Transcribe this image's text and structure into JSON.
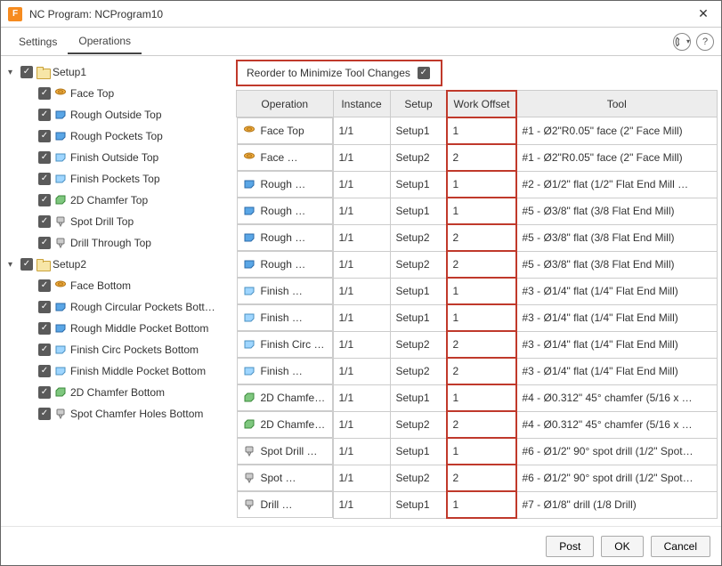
{
  "window": {
    "title": "NC Program: NCProgram10"
  },
  "tabs": {
    "settings": "Settings",
    "operations": "Operations"
  },
  "reorder": {
    "label": "Reorder to Minimize Tool Changes",
    "checked": true
  },
  "buttons": {
    "post": "Post",
    "ok": "OK",
    "cancel": "Cancel"
  },
  "columns": {
    "operation": "Operation",
    "instance": "Instance",
    "setup": "Setup",
    "offset": "Work Offset",
    "tool": "Tool"
  },
  "tree": [
    {
      "label": "Setup1",
      "children": [
        {
          "label": "Face Top",
          "icon": "face"
        },
        {
          "label": "Rough Outside Top",
          "icon": "rough"
        },
        {
          "label": "Rough Pockets Top",
          "icon": "rough"
        },
        {
          "label": "Finish Outside Top",
          "icon": "finish"
        },
        {
          "label": "Finish Pockets Top",
          "icon": "finish"
        },
        {
          "label": "2D Chamfer Top",
          "icon": "chamfer"
        },
        {
          "label": "Spot Drill Top",
          "icon": "drill"
        },
        {
          "label": "Drill Through Top",
          "icon": "drill"
        }
      ]
    },
    {
      "label": "Setup2",
      "children": [
        {
          "label": "Face Bottom",
          "icon": "face"
        },
        {
          "label": "Rough Circular Pockets Bott…",
          "icon": "rough"
        },
        {
          "label": "Rough Middle Pocket Bottom",
          "icon": "rough"
        },
        {
          "label": "Finish Circ Pockets  Bottom",
          "icon": "finish"
        },
        {
          "label": "Finish Middle Pocket Bottom",
          "icon": "finish"
        },
        {
          "label": "2D Chamfer Bottom",
          "icon": "chamfer"
        },
        {
          "label": "Spot Chamfer Holes Bottom",
          "icon": "drill"
        }
      ]
    }
  ],
  "rows": [
    {
      "op": "Face Top",
      "icon": "face",
      "inst": "1/1",
      "setup": "Setup1",
      "off": "1",
      "tool": "#1 - Ø2\"R0.05\" face (2\" Face Mill)"
    },
    {
      "op": "Face …",
      "icon": "face",
      "inst": "1/1",
      "setup": "Setup2",
      "off": "2",
      "tool": "#1 - Ø2\"R0.05\" face (2\" Face Mill)"
    },
    {
      "op": "Rough …",
      "icon": "rough",
      "inst": "1/1",
      "setup": "Setup1",
      "off": "1",
      "tool": "#2 - Ø1/2\" flat (1/2\" Flat End Mill …"
    },
    {
      "op": "Rough …",
      "icon": "rough",
      "inst": "1/1",
      "setup": "Setup1",
      "off": "1",
      "tool": "#5 - Ø3/8\" flat (3/8 Flat End Mill)"
    },
    {
      "op": "Rough …",
      "icon": "rough",
      "inst": "1/1",
      "setup": "Setup2",
      "off": "2",
      "tool": "#5 - Ø3/8\" flat (3/8 Flat End Mill)"
    },
    {
      "op": "Rough …",
      "icon": "rough",
      "inst": "1/1",
      "setup": "Setup2",
      "off": "2",
      "tool": "#5 - Ø3/8\" flat (3/8 Flat End Mill)"
    },
    {
      "op": "Finish …",
      "icon": "finish",
      "inst": "1/1",
      "setup": "Setup1",
      "off": "1",
      "tool": "#3 - Ø1/4\" flat (1/4\" Flat End Mill)"
    },
    {
      "op": "Finish …",
      "icon": "finish",
      "inst": "1/1",
      "setup": "Setup1",
      "off": "1",
      "tool": "#3 - Ø1/4\" flat (1/4\" Flat End Mill)"
    },
    {
      "op": "Finish Circ …",
      "icon": "finish",
      "inst": "1/1",
      "setup": "Setup2",
      "off": "2",
      "tool": "#3 - Ø1/4\" flat (1/4\" Flat End Mill)"
    },
    {
      "op": "Finish …",
      "icon": "finish",
      "inst": "1/1",
      "setup": "Setup2",
      "off": "2",
      "tool": "#3 - Ø1/4\" flat (1/4\" Flat End Mill)"
    },
    {
      "op": "2D Chamfe…",
      "icon": "chamfer",
      "inst": "1/1",
      "setup": "Setup1",
      "off": "1",
      "tool": "#4 - Ø0.312\" 45° chamfer (5/16 x …"
    },
    {
      "op": "2D Chamfe…",
      "icon": "chamfer",
      "inst": "1/1",
      "setup": "Setup2",
      "off": "2",
      "tool": "#4 - Ø0.312\" 45° chamfer (5/16 x …"
    },
    {
      "op": "Spot Drill …",
      "icon": "drill",
      "inst": "1/1",
      "setup": "Setup1",
      "off": "1",
      "tool": "#6 - Ø1/2\" 90° spot drill (1/2\" Spot…"
    },
    {
      "op": "Spot …",
      "icon": "drill",
      "inst": "1/1",
      "setup": "Setup2",
      "off": "2",
      "tool": "#6 - Ø1/2\" 90° spot drill (1/2\" Spot…"
    },
    {
      "op": "Drill …",
      "icon": "drill",
      "inst": "1/1",
      "setup": "Setup1",
      "off": "1",
      "tool": "#7 - Ø1/8\" drill (1/8 Drill)"
    }
  ]
}
